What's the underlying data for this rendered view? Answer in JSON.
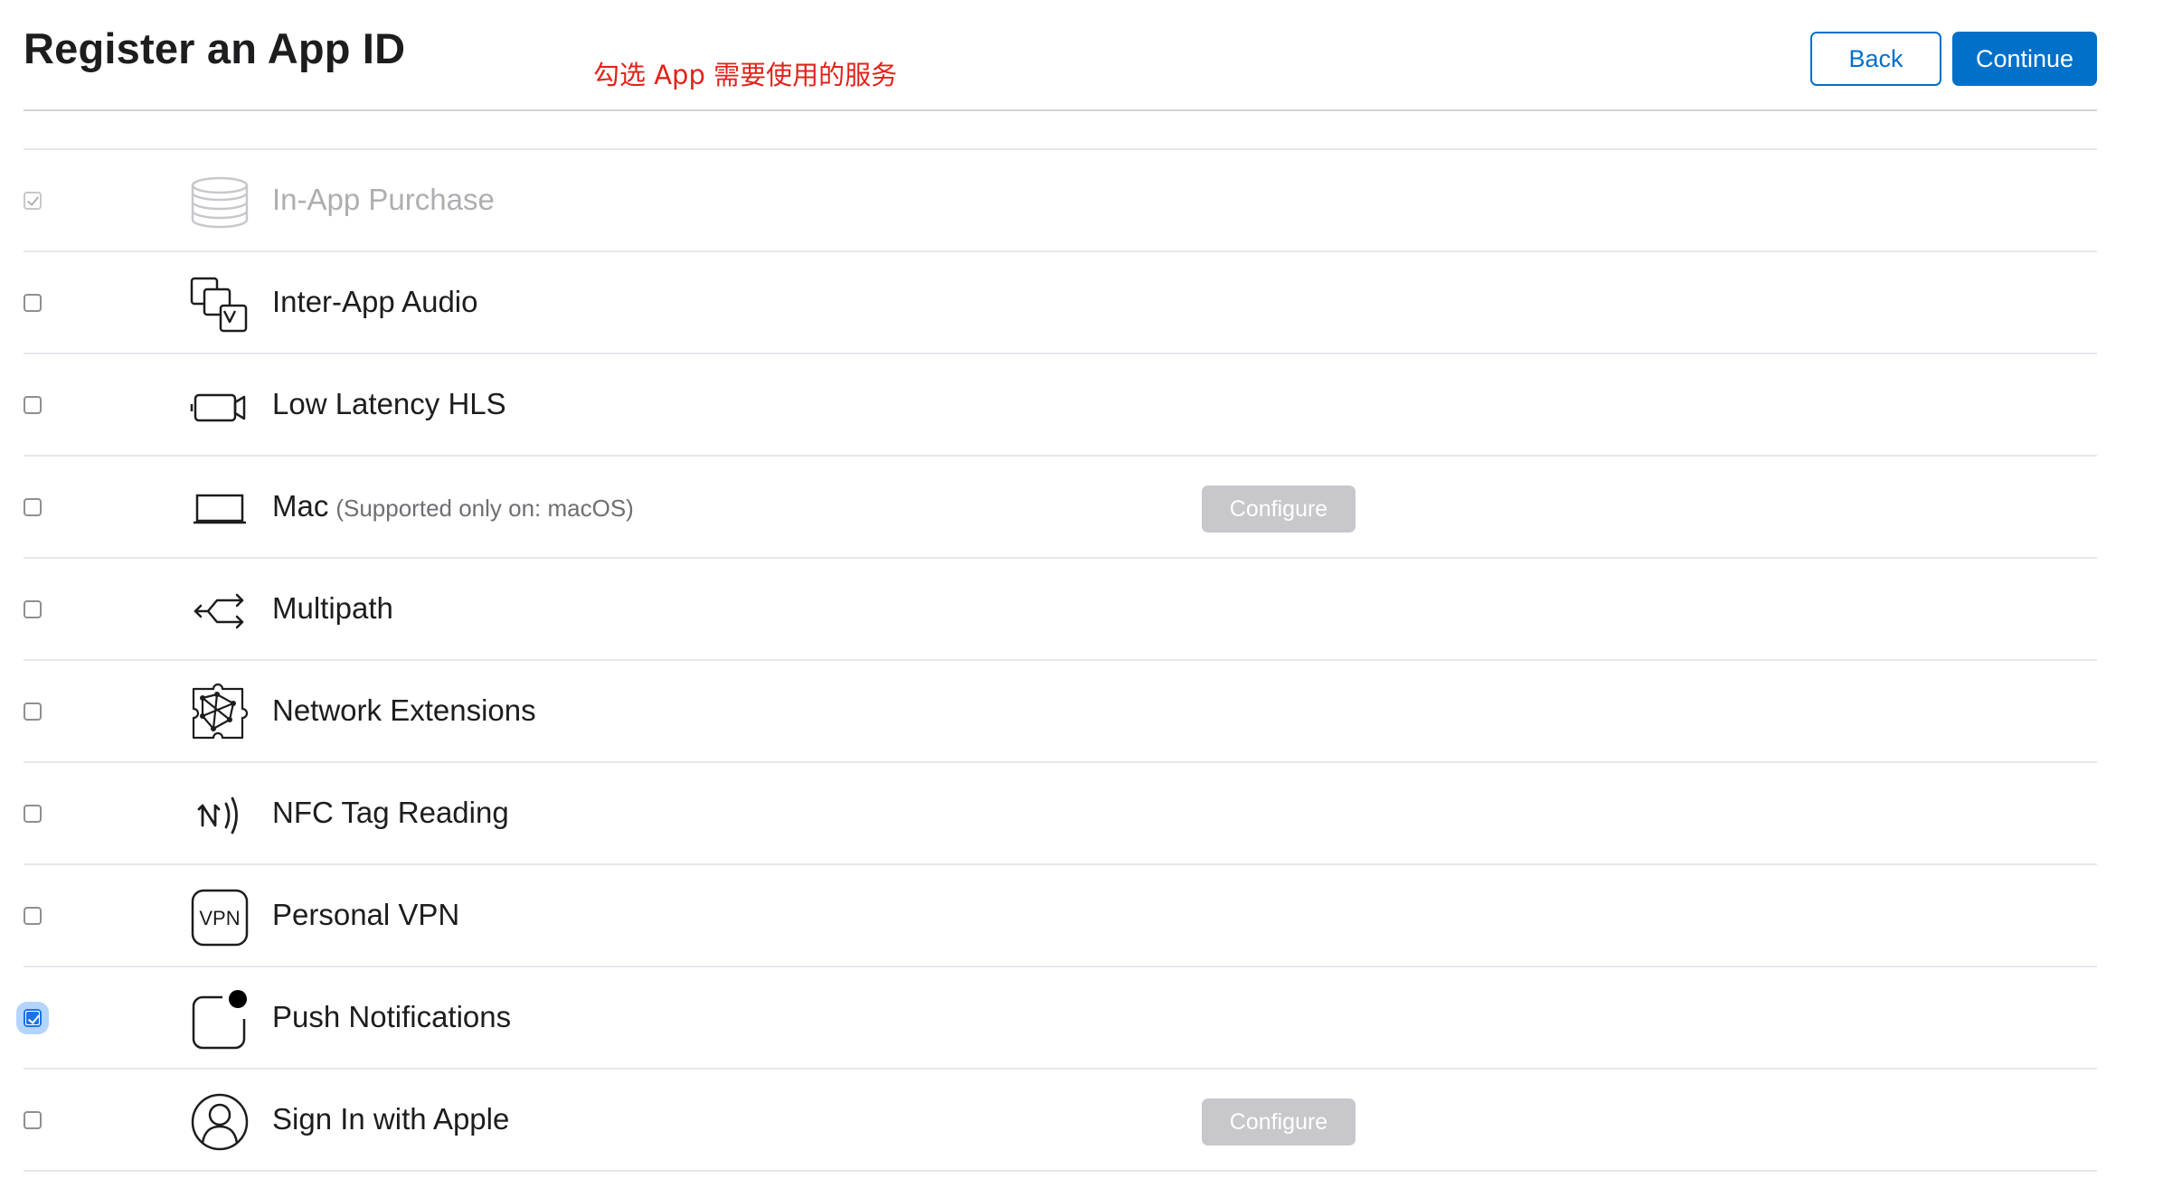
{
  "header": {
    "title": "Register an App ID",
    "annotation": "勾选 App 需要使用的服务",
    "back_label": "Back",
    "continue_label": "Continue"
  },
  "services": [
    {
      "label": "In-App Purchase",
      "state": "checked-disabled",
      "icon": "coins-stack-icon"
    },
    {
      "label": "Inter-App Audio",
      "state": "unchecked",
      "icon": "inter-app-audio-icon"
    },
    {
      "label": "Low Latency HLS",
      "state": "unchecked",
      "icon": "video-camera-icon"
    },
    {
      "label": "Mac",
      "note": "(Supported only on: macOS)",
      "state": "unchecked",
      "icon": "laptop-icon",
      "configure": "Configure"
    },
    {
      "label": "Multipath",
      "state": "unchecked",
      "icon": "multipath-arrows-icon"
    },
    {
      "label": "Network Extensions",
      "state": "unchecked",
      "icon": "network-extensions-icon"
    },
    {
      "label": "NFC Tag Reading",
      "state": "unchecked",
      "icon": "nfc-icon"
    },
    {
      "label": "Personal VPN",
      "state": "unchecked",
      "icon": "vpn-icon"
    },
    {
      "label": "Push Notifications",
      "state": "checked",
      "icon": "push-notification-icon"
    },
    {
      "label": "Sign In with Apple",
      "state": "unchecked",
      "icon": "person-circle-icon",
      "configure": "Configure"
    }
  ],
  "colors": {
    "accent": "#0070c9",
    "annotation": "#e0231b",
    "configure_disabled": "#c7c7cc"
  }
}
